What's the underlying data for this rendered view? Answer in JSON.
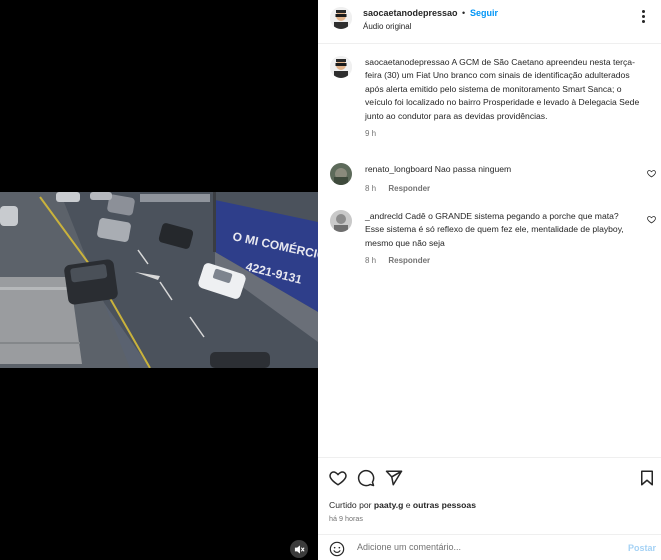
{
  "post": {
    "username": "saocaetanodepressao",
    "dot": "•",
    "follow_label": "Seguir",
    "audio_label": "Áudio original"
  },
  "caption": {
    "username": "saocaetanodepressao",
    "text": "A GCM de São Caetano apreendeu nesta terça-feira (30) um Fiat Uno branco com sinais de identificação adulterados após alerta emitido pelo sistema de monitoramento Smart Sanca; o veículo foi localizado no bairro Prosperidade e levado à Delegacia Sede junto ao condutor para as devidas providências.",
    "time": "9 h"
  },
  "comments": [
    {
      "username": "renato_longboard",
      "text": "Nao passa ninguem",
      "time": "8 h",
      "reply_label": "Responder"
    },
    {
      "username": "_andrecld",
      "text": "Cadê o GRANDE sistema pegando a porche que mata? Esse sistema é só reflexo de quem fez ele, mentalidade de playboy, mesmo que não seja",
      "time": "8 h",
      "reply_label": "Responder"
    }
  ],
  "likes": {
    "prefix": "Curtido por ",
    "user": "paaty.g",
    "middle": " e ",
    "others": "outras pessoas"
  },
  "time_ago": "há 9 horas",
  "comment_box": {
    "placeholder": "Adicione um comentário...",
    "post_label": "Postar"
  },
  "video_overlay": {
    "sign_line1": "O MI COMÉRCIO D",
    "sign_line2": "4221-9131"
  },
  "colors": {
    "accent": "#0095f6",
    "post_disabled": "#a5d2f5",
    "secondary_text": "#737373"
  },
  "icons": [
    "more-options-icon",
    "heart-icon",
    "comment-icon",
    "share-icon",
    "save-icon",
    "emoji-icon",
    "mute-icon"
  ]
}
